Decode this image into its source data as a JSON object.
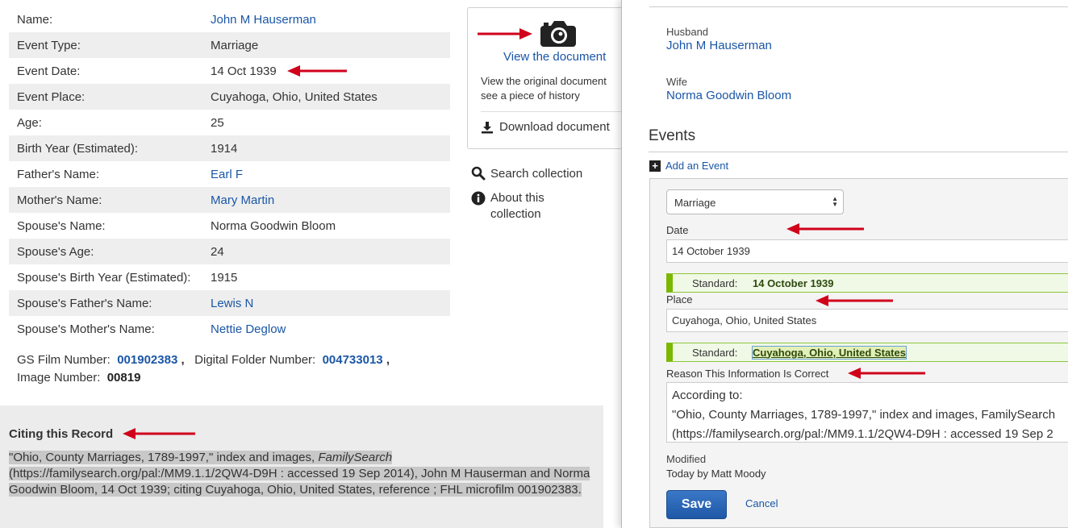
{
  "record": {
    "rows": [
      {
        "label": "Name:",
        "value": "John M Hauserman",
        "link": true
      },
      {
        "label": "Event Type:",
        "value": "Marriage",
        "link": false
      },
      {
        "label": "Event Date:",
        "value": "14 Oct 1939",
        "link": false
      },
      {
        "label": "Event Place:",
        "value": "Cuyahoga, Ohio, United States",
        "link": false
      },
      {
        "label": "Age:",
        "value": "25",
        "link": false
      },
      {
        "label": "Birth Year (Estimated):",
        "value": "1914",
        "link": false
      },
      {
        "label": "Father's Name:",
        "value": "Earl F",
        "link": true
      },
      {
        "label": "Mother's Name:",
        "value": "Mary Martin",
        "link": true
      },
      {
        "label": "Spouse's Name:",
        "value": "Norma Goodwin Bloom",
        "link": false
      },
      {
        "label": "Spouse's Age:",
        "value": "24",
        "link": false
      },
      {
        "label": "Spouse's Birth Year (Estimated):",
        "value": "1915",
        "link": false
      },
      {
        "label": "Spouse's Father's Name:",
        "value": "Lewis N",
        "link": true
      },
      {
        "label": "Spouse's Mother's Name:",
        "value": "Nettie Deglow",
        "link": true
      }
    ],
    "film": {
      "gs_label": "GS Film Number:",
      "gs_value": "001902383",
      "folder_label": "Digital Folder Number:",
      "folder_value": "004733013",
      "image_label": "Image Number:",
      "image_value": "00819"
    }
  },
  "document": {
    "view_label": "View the document",
    "desc_line1": "View the original document",
    "desc_line2": "see a piece of history",
    "download_label": "Download document"
  },
  "collection": {
    "search_label": "Search collection",
    "about_line1": "About this",
    "about_line2": "collection"
  },
  "citation": {
    "title": "Citing this Record",
    "text_part1": "\"Ohio, County Marriages, 1789-1997,\" index and images, ",
    "text_italic": "FamilySearch",
    "text_part2": " (https://familysearch.org/pal:/MM9.1.1/2QW4-D9H : accessed 19 Sep 2014), John M Hauserman and Norma Goodwin Bloom, 14 Oct 1939; citing Cuyahoga, Ohio, United States, reference ; FHL microfilm 001902383."
  },
  "right_panel": {
    "husband_label": "Husband",
    "husband_name": "John M Hauserman",
    "wife_label": "Wife",
    "wife_name": "Norma Goodwin Bloom",
    "events_heading": "Events",
    "add_event_label": "Add an Event",
    "event_type_selected": "Marriage",
    "date_label": "Date",
    "date_value": "14 October 1939",
    "standard_label": "Standard:",
    "date_standard": "14 October 1939",
    "place_label": "Place",
    "place_value": "Cuyahoga, Ohio, United States",
    "place_standard": "Cuyahoga, Ohio, United States",
    "reason_label": "Reason This Information Is Correct",
    "reason_line1": "According to:",
    "reason_line2": "\"Ohio, County Marriages, 1789-1997,\" index and images, FamilySearch",
    "reason_line3": "(https://familysearch.org/pal:/MM9.1.1/2QW4-D9H : accessed 19 Sep 2",
    "modified_label": "Modified",
    "modified_value": "Today by Matt Moody",
    "save_label": "Save",
    "cancel_label": "Cancel"
  },
  "colors": {
    "link": "#1a56a6",
    "arrow": "#d0021b",
    "standard_green": "#7ab800"
  }
}
